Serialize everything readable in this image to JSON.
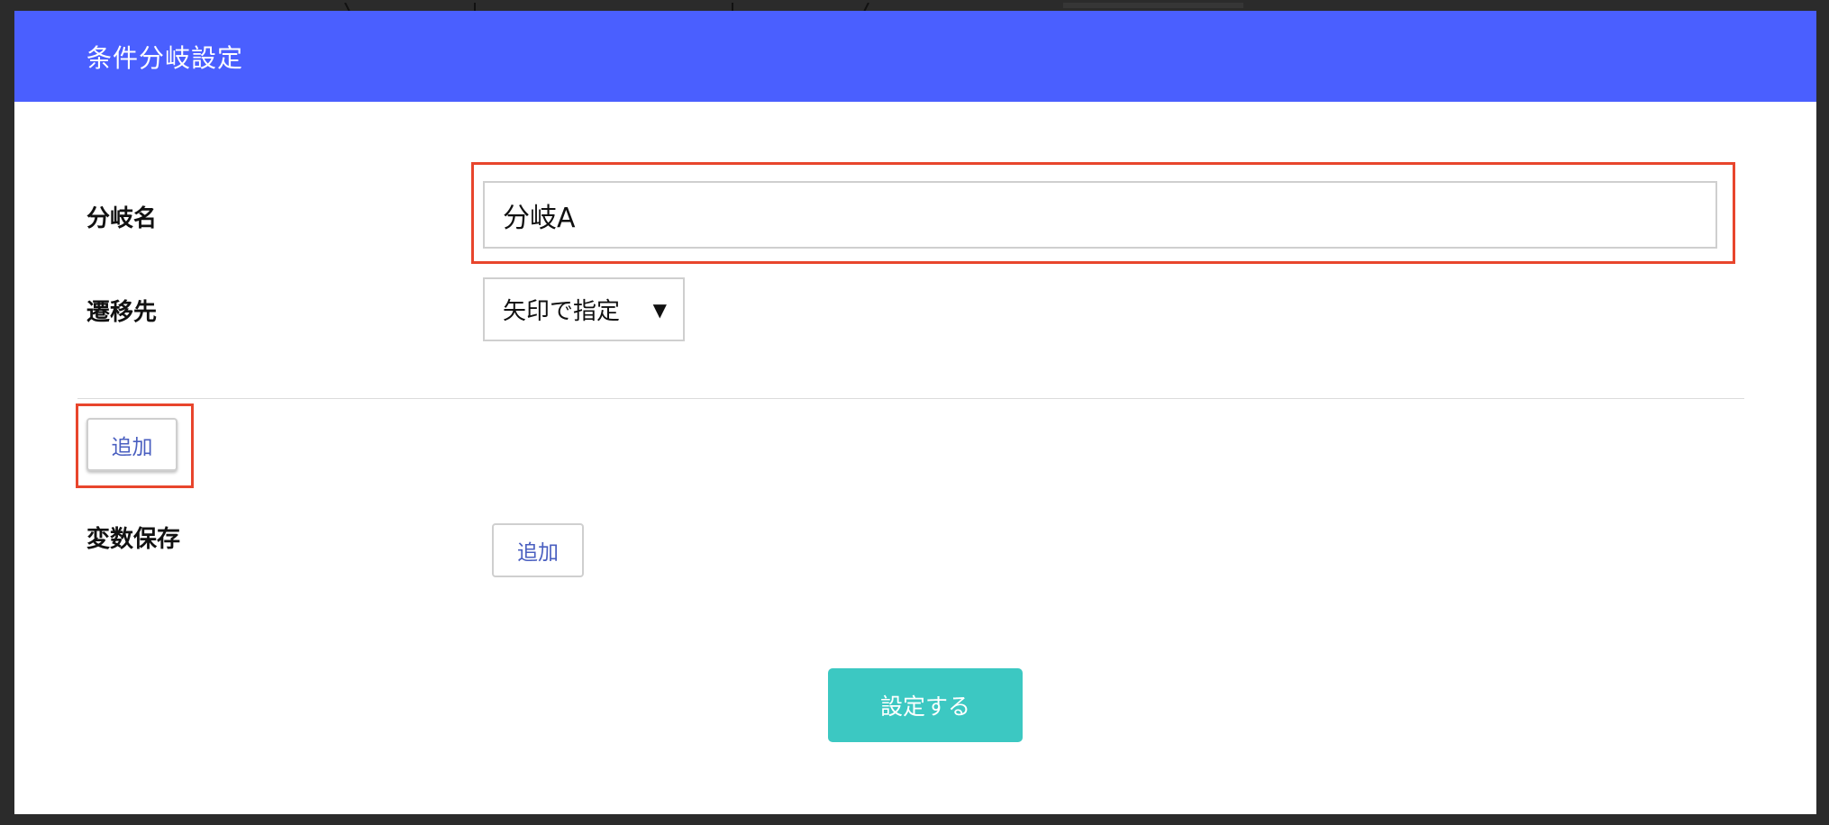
{
  "modal": {
    "title": "条件分岐設定"
  },
  "form": {
    "branch_name": {
      "label": "分岐名",
      "value": "分岐A"
    },
    "destination": {
      "label": "遷移先",
      "selected": "矢印で指定",
      "arrow_icon": "▼"
    },
    "condition_add_label": "追加",
    "variable_save": {
      "label": "変数保存",
      "add_label": "追加"
    },
    "submit_label": "設定する"
  },
  "colors": {
    "header": "#4a5fff",
    "primary_button": "#3cc8c2",
    "annotation": "#e8452c",
    "backdrop": "#2b2b2b"
  }
}
